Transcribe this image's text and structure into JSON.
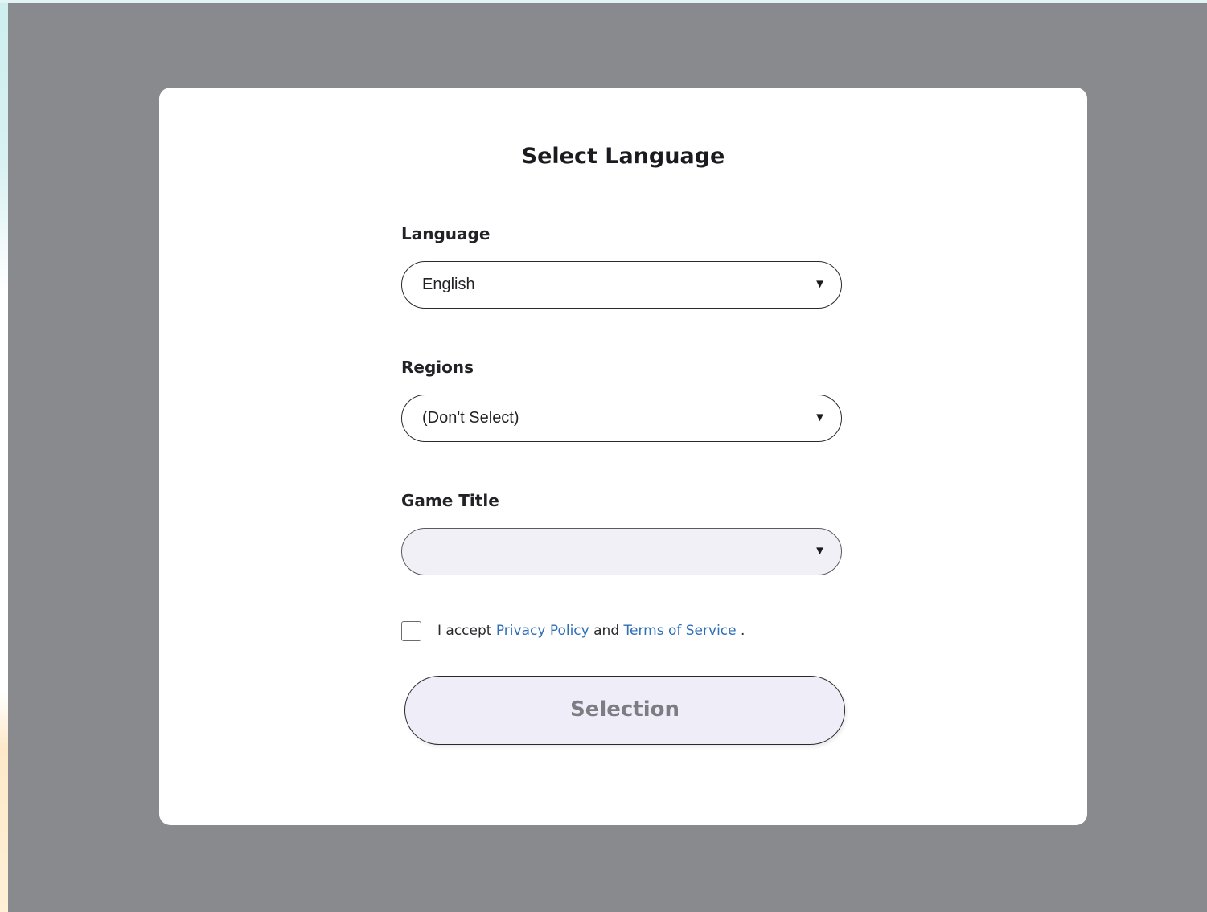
{
  "dialog": {
    "title": "Select Language",
    "language": {
      "label": "Language",
      "selected": "English"
    },
    "regions": {
      "label": "Regions",
      "selected": "(Don't Select)"
    },
    "game_title": {
      "label": "Game Title",
      "selected": ""
    },
    "consent": {
      "prefix": "I accept ",
      "privacy_link": "Privacy Policy ",
      "conjunction": "and ",
      "terms_link": "Terms of Service ",
      "suffix": "."
    },
    "submit_label": "Selection"
  },
  "icons": {
    "dropdown": "caret-down-icon"
  },
  "colors": {
    "overlay": "#898a8e",
    "link": "#2e6fb8",
    "button_fill": "#efeef8",
    "button_text_disabled": "#7c7c82"
  }
}
